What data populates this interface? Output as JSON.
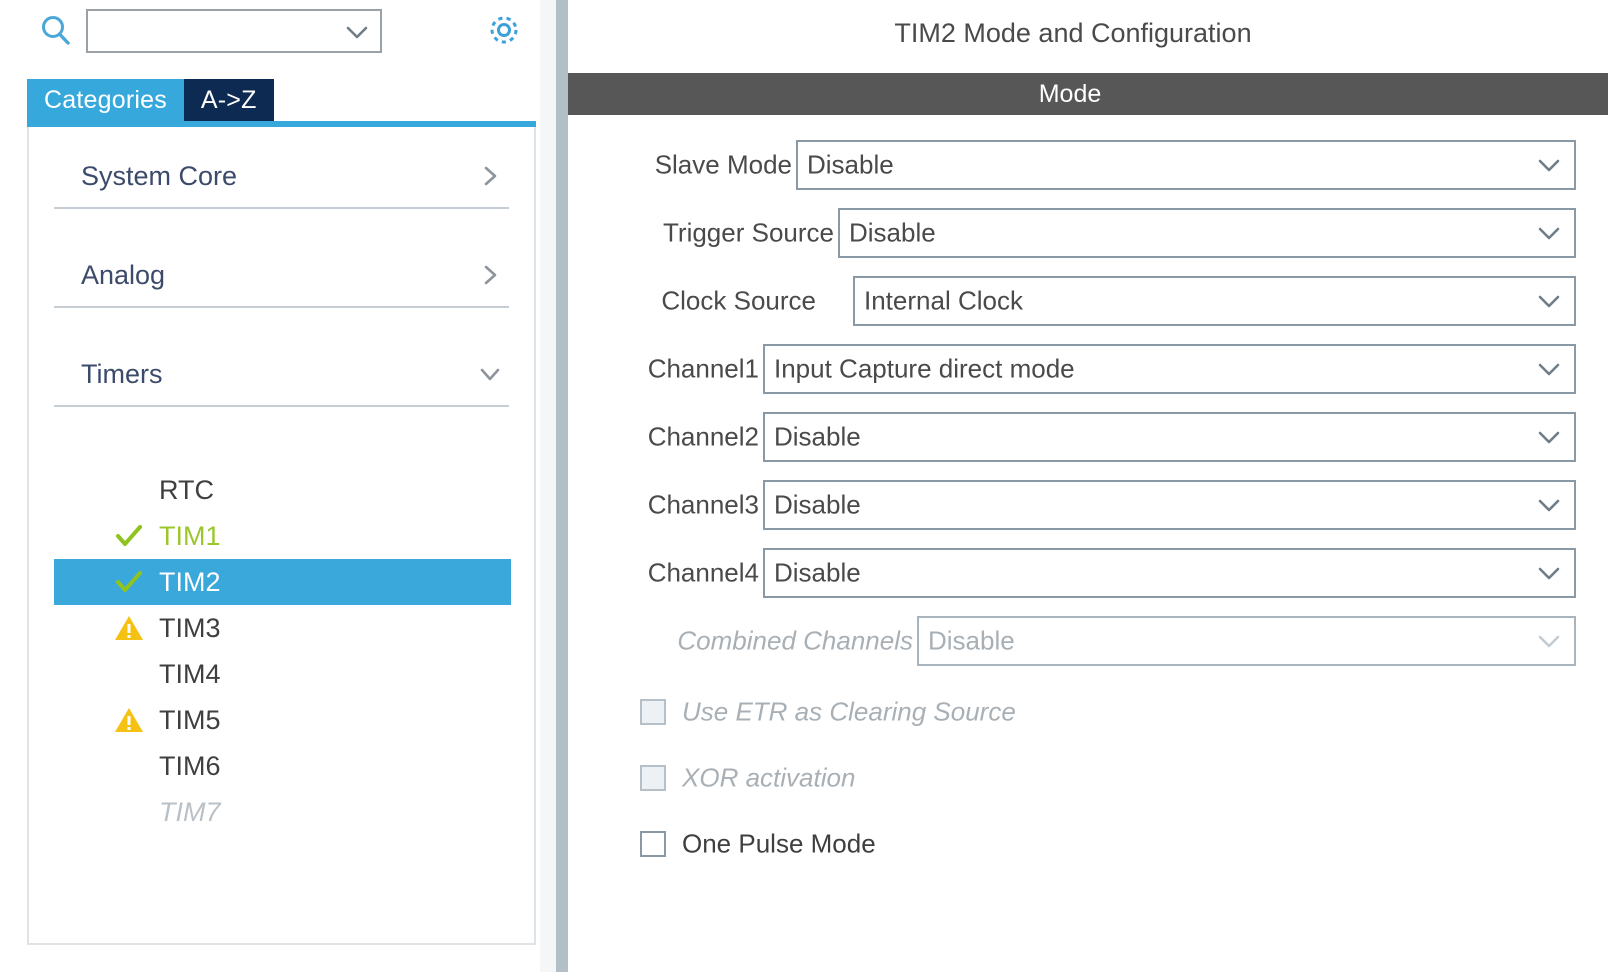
{
  "left_panel": {
    "search": {
      "value": "",
      "placeholder": "",
      "icon": "search-icon",
      "dropdown_icon": "chevron-down-icon"
    },
    "settings_icon": "gear-icon",
    "tabs": [
      {
        "label": "Categories",
        "active": true
      },
      {
        "label": "A->Z",
        "active": false
      }
    ],
    "categories": [
      {
        "label": "System Core",
        "expanded": false,
        "arrow_icon": "chevron-right-icon"
      },
      {
        "label": "Analog",
        "expanded": false,
        "arrow_icon": "chevron-right-icon"
      },
      {
        "label": "Timers",
        "expanded": true,
        "arrow_icon": "chevron-down-icon"
      }
    ],
    "sort_widget": {
      "up_icon": "sort-ascending-icon",
      "down_icon": "sort-descending-icon"
    },
    "timers": [
      {
        "label": "RTC",
        "state": "normal",
        "icon": ""
      },
      {
        "label": "TIM1",
        "state": "configured",
        "icon": "check-icon"
      },
      {
        "label": "TIM2",
        "state": "selected",
        "icon": "check-icon"
      },
      {
        "label": "TIM3",
        "state": "warning",
        "icon": "warning-icon"
      },
      {
        "label": "TIM4",
        "state": "normal",
        "icon": ""
      },
      {
        "label": "TIM5",
        "state": "warning",
        "icon": "warning-icon"
      },
      {
        "label": "TIM6",
        "state": "normal",
        "icon": ""
      },
      {
        "label": "TIM7",
        "state": "disabled",
        "icon": ""
      }
    ]
  },
  "right_panel": {
    "title": "TIM2 Mode and Configuration",
    "section_header": "Mode",
    "fields": [
      {
        "label": "Slave Mode",
        "value": "Disable",
        "enabled": true
      },
      {
        "label": "Trigger Source",
        "value": "Disable",
        "enabled": true
      },
      {
        "label": "Clock Source",
        "value": "Internal Clock",
        "enabled": true
      },
      {
        "label": "Channel1",
        "value": "Input Capture direct mode",
        "enabled": true
      },
      {
        "label": "Channel2",
        "value": "Disable",
        "enabled": true
      },
      {
        "label": "Channel3",
        "value": "Disable",
        "enabled": true
      },
      {
        "label": "Channel4",
        "value": "Disable",
        "enabled": true
      },
      {
        "label": "Combined Channels",
        "value": "Disable",
        "enabled": false
      }
    ],
    "checkboxes": [
      {
        "label": "Use ETR as Clearing Source",
        "checked": false,
        "enabled": false
      },
      {
        "label": "XOR activation",
        "checked": false,
        "enabled": false
      },
      {
        "label": "One Pulse Mode",
        "checked": false,
        "enabled": true
      }
    ]
  },
  "colors": {
    "accent_blue": "#37a8dc",
    "tab_navy": "#0c2a52",
    "selection_blue": "#3ba8db",
    "configured_green": "#9bc72b",
    "warning_yellow": "#f5c214",
    "section_header_gray": "#575757",
    "category_text": "#3c4a6b"
  }
}
